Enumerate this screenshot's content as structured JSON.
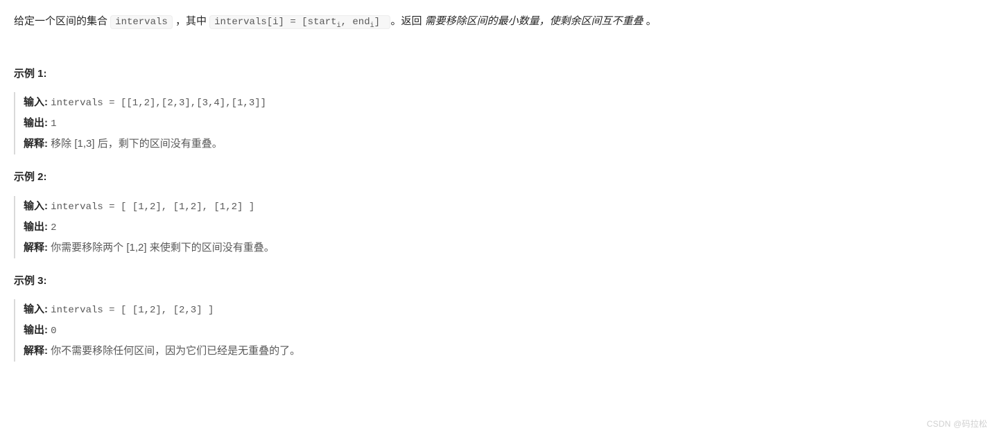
{
  "description": {
    "prefix": "给定一个区间的集合 ",
    "code1": "intervals",
    "middle1": " ，其中 ",
    "code2_prefix": "intervals[i] = [start",
    "code2_sub1": "i",
    "code2_mid": ", end",
    "code2_sub2": "i",
    "code2_suffix": "]",
    "middle2": " 。返回 ",
    "italic": "需要移除区间的最小数量，使剩余区间互不重叠",
    "tail": " 。"
  },
  "sectionLabels": {
    "example1": "示例 1:",
    "example2": "示例 2:",
    "example3": "示例 3:",
    "input": "输入:",
    "output": "输出:",
    "explain": "解释:"
  },
  "example1": {
    "input": "intervals = [[1,2],[2,3],[3,4],[1,3]]",
    "output": "1",
    "explain": "移除 [1,3] 后，剩下的区间没有重叠。"
  },
  "example2": {
    "input": "intervals = [ [1,2], [1,2], [1,2] ]",
    "output": "2",
    "explain": "你需要移除两个 [1,2] 来使剩下的区间没有重叠。"
  },
  "example3": {
    "input": "intervals = [ [1,2], [2,3] ]",
    "output": "0",
    "explain": "你不需要移除任何区间，因为它们已经是无重叠的了。"
  },
  "watermark": "CSDN @码拉松"
}
